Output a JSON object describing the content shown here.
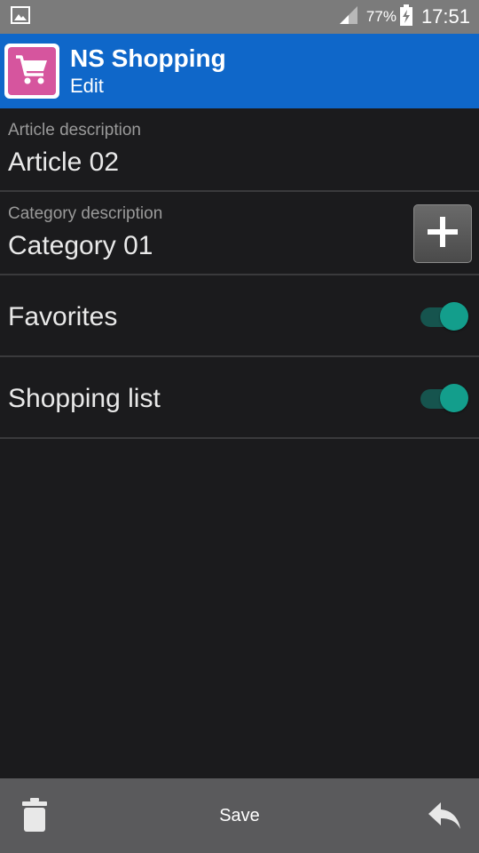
{
  "status_bar": {
    "battery_percent": "77%",
    "time": "17:51"
  },
  "app_bar": {
    "title": "NS Shopping",
    "subtitle": "Edit"
  },
  "form": {
    "article": {
      "label": "Article description",
      "value": "Article 02"
    },
    "category": {
      "label": "Category description",
      "value": "Category 01"
    },
    "favorites": {
      "label": "Favorites",
      "checked": true
    },
    "shopping_list": {
      "label": "Shopping list",
      "checked": true
    }
  },
  "bottom_bar": {
    "save_label": "Save"
  },
  "icons": {
    "status_left": "image-icon",
    "signal": "signal-icon",
    "battery": "battery-charging-icon",
    "app_logo": "shopping-cart-icon",
    "add": "plus-icon",
    "delete": "trash-icon",
    "back": "reply-icon"
  },
  "colors": {
    "app_bar": "#0f67c9",
    "status_bar": "#7b7b7b",
    "background": "#1b1b1d",
    "logo": "#d6559e",
    "switch_on": "#139e8c",
    "bottom_bar": "#5a5a5c"
  }
}
